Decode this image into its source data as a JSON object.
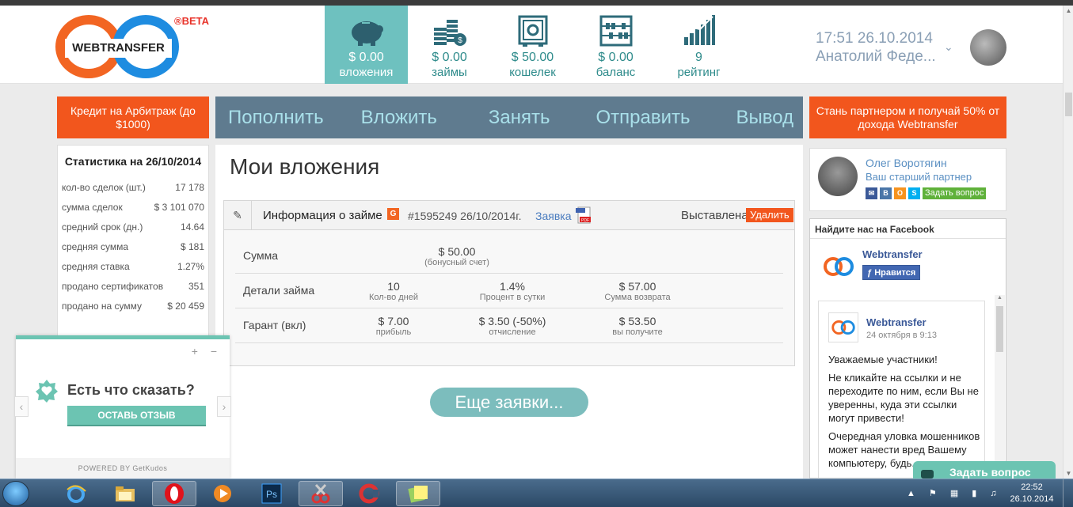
{
  "header": {
    "logo_text": "WEBTRANSFER",
    "beta": "®BETA",
    "nav": [
      {
        "value": "$ 0.00",
        "label": "вложения",
        "icon": "piggy-bank-icon",
        "active": true
      },
      {
        "value": "$ 0.00",
        "label": "займы",
        "icon": "coins-icon",
        "active": false
      },
      {
        "value": "$ 50.00",
        "label": "кошелек",
        "icon": "safe-icon",
        "active": false
      },
      {
        "value": "$ 0.00",
        "label": "баланс",
        "icon": "abacus-icon",
        "active": false
      },
      {
        "value": "9",
        "label": "рейтинг",
        "icon": "rating-chart-icon",
        "active": false
      }
    ],
    "datetime": "17:51 26.10.2014",
    "user": "Анатолий Феде..."
  },
  "promo_left": "Кредит на Арбитраж (до $1000)",
  "promo_right": "Стань партнером и получай 50% от дохода Webtransfer",
  "mainnav": [
    "Пополнить",
    "Вложить",
    "Занять",
    "Отправить",
    "Вывод"
  ],
  "stats": {
    "title": "Статистика на 26/10/2014",
    "rows": [
      {
        "label": "кол-во сделок (шт.)",
        "value": "17 178"
      },
      {
        "label": "сумма сделок",
        "value": "$ 3 101 070"
      },
      {
        "label": "средний срок (дн.)",
        "value": "14.64"
      },
      {
        "label": "средняя сумма",
        "value": "$ 181"
      },
      {
        "label": "средняя ставка",
        "value": "1.27%"
      },
      {
        "label": "продано сертификатов",
        "value": "351"
      },
      {
        "label": "продано на сумму",
        "value": "$ 20 459"
      }
    ]
  },
  "content": {
    "title": "Мои вложения",
    "loan": {
      "title": "Информация о займе",
      "badge": "G",
      "number": "#1595249 26/10/2014г.",
      "link": "Заявка",
      "status": "Выставлена",
      "delete": "Удалить",
      "rows": [
        {
          "name": "Сумма",
          "cells": [
            {
              "v": "$ 50.00",
              "s": "(бонусный счет)"
            }
          ]
        },
        {
          "name": "Детали займа",
          "cells": [
            {
              "v": "10",
              "s": "Кол-во дней"
            },
            {
              "v": "1.4%",
              "s": "Процент в сутки"
            },
            {
              "v": "$ 57.00",
              "s": "Сумма возврата"
            }
          ]
        },
        {
          "name": "Гарант (вкл)",
          "cells": [
            {
              "v": "$ 7.00",
              "s": "прибыль"
            },
            {
              "v": "$ 3.50 (-50%)",
              "s": "отчисление"
            },
            {
              "v": "$ 53.50",
              "s": "вы получите"
            }
          ]
        }
      ]
    },
    "more": "Еще заявки..."
  },
  "partner": {
    "name": "Олег Воротягин",
    "role": "Ваш старший партнер",
    "ask": "Задать вопрос"
  },
  "facebook": {
    "title": "Найдите нас на Facebook",
    "page": "Webtransfer",
    "like": "Нравится",
    "post_author": "Webtransfer",
    "post_date": "24 октября в 9:13",
    "post_p1": "Уважаемые участники!",
    "post_p2": "Не кликайте на ссылки и не переходите по ним, если Вы не уверенны, куда эти ссылки могут привести!",
    "post_p3": "Очередная уловка мошенников может нанести вред Вашему компьютеру, будь..."
  },
  "ask_tab": "Задать вопрос",
  "kudos": {
    "title": "Есть что сказать?",
    "button": "ОСТАВЬ ОТЗЫВ",
    "footer": "POWERED BY GetKudos",
    "controls": "+ −"
  },
  "taskbar": {
    "time": "22:52",
    "date": "26.10.2014"
  },
  "colors": {
    "accent_orange": "#f2561d",
    "nav_bar": "#5f7b8f",
    "teal": "#6ec1bf"
  }
}
